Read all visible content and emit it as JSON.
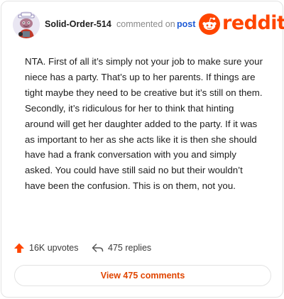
{
  "header": {
    "username": "Solid-Order-514",
    "commented_text": "commented on",
    "post_link": "post",
    "brand": "reddit"
  },
  "comment": {
    "body": "NTA. First of all it’s simply not your job to make sure your niece has a party. That’s up to her parents. If things are tight maybe they need to be creative but it’s still on them. Secondly, it’s ridiculous for her to think that hinting around will get her daughter added to the party. If it was as important to her as she acts like it is then she should have had a frank conversation with you and simply asked. You could have still said no but their wouldn’t have been the confusion. This is on them, not you."
  },
  "footer": {
    "upvotes": "16K upvotes",
    "replies": "475 replies",
    "view_comments": "View 475 comments"
  },
  "colors": {
    "brand": "#ff4500",
    "link": "#1f5bd6",
    "view_button_text": "#e04500"
  },
  "icons": {
    "avatar": "snoo-avatar",
    "logo": "reddit-snoo-icon",
    "upvote": "upvote-arrow-icon",
    "reply": "reply-arrow-icon"
  }
}
